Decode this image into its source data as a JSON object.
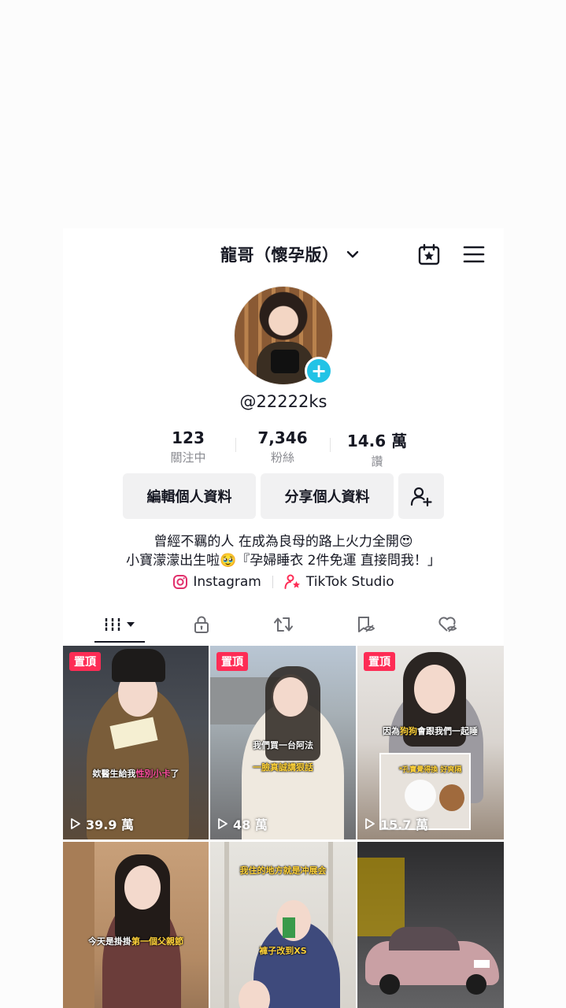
{
  "header": {
    "username": "龍哥（懷孕版）"
  },
  "profile": {
    "handle": "@22222ks"
  },
  "stats": [
    {
      "value": "123",
      "label": "關注中"
    },
    {
      "value": "7,346",
      "label": "粉絲"
    },
    {
      "value": "14.6 萬",
      "label": "讚"
    }
  ],
  "buttons": {
    "edit_profile": "編輯個人資料",
    "share_profile": "分享個人資料"
  },
  "bio": {
    "line1": "曾經不羈的人 在成為良母的路上火力全開😍",
    "line2": "小寶濛濛出生啦🥹『孕婦睡衣 2件免運 直接問我！」"
  },
  "links": {
    "instagram": "Instagram",
    "tiktok_studio": "TikTok Studio"
  },
  "videos": [
    {
      "pinned": "置頂",
      "views": "39.9 萬",
      "caption_a": "欸醫生給我",
      "caption_b": "性別小卡",
      "caption_c": "了"
    },
    {
      "pinned": "置頂",
      "views": "48 萬",
      "caption_top": "我們買一台阿法",
      "caption_bottom": "一臉真誠講狠話"
    },
    {
      "pinned": "置頂",
      "views": "15.7 萬",
      "caption_a": "因為",
      "caption_b": "狗狗",
      "caption_c": "會跟我們一起睡",
      "caption_small": "*孔寶覺得換 好爽隔"
    },
    {
      "caption_a": "今天是掛掛",
      "caption_b": "第一個父親節"
    },
    {
      "caption_top": "我住的地方就是冲展会",
      "caption_bottom": "褲子改到XS"
    },
    {}
  ],
  "colors": {
    "accent": "#fe2c55",
    "badge": "#22c3e6"
  }
}
